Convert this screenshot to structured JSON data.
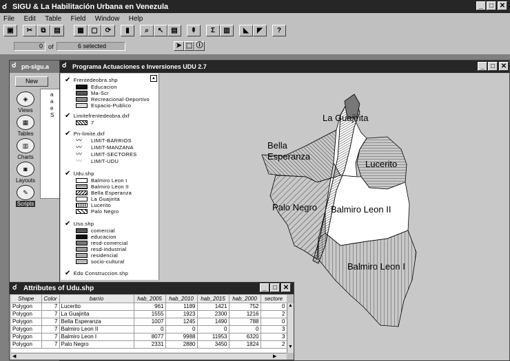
{
  "app": {
    "title": "SIGU & La Habilitación Urbana en Venezula"
  },
  "menu": [
    "File",
    "Edit",
    "Table",
    "Field",
    "Window",
    "Help"
  ],
  "toolbar": {
    "buttons": [
      "save",
      "cut",
      "copy",
      "paste",
      "table-view",
      "layout",
      "refresh",
      "chart",
      "find",
      "query",
      "select-all",
      "promote",
      "sum",
      "stats",
      "clear",
      "sort-asc",
      "sort-desc",
      "help"
    ]
  },
  "status": {
    "count_value": "0",
    "count_of": "of",
    "selected_value": "6",
    "selected_label": "selected"
  },
  "project_window": {
    "title": "pn-sigu.a",
    "new_button": "New",
    "items": [
      "Views",
      "Tables",
      "Charts",
      "Layouts",
      "Scripts"
    ],
    "list": [
      "a",
      "a",
      "e",
      "S"
    ]
  },
  "view_window": {
    "title": "Programa Actuaciones e Inversiones UDU 2.7"
  },
  "legend": {
    "themes": [
      {
        "name": "Frentedeobra.shp",
        "classes": [
          "Educacion",
          "Ma-Scr",
          "Recreacional-Deportivo",
          "Espacio-Publico"
        ]
      },
      {
        "name": "Limitefrentedeobra.dxf",
        "classes": [
          "7"
        ]
      },
      {
        "name": "Pn-limite.dxf",
        "classes": [
          "LIMIT-BARRIOS",
          "LIMIT-MANZANA",
          "LIMIT-SECTORES",
          "LIMIT-UDU"
        ]
      },
      {
        "name": "Udu.shp",
        "classes": [
          "Balmiro Leon I",
          "Balmiro Leon II",
          "Bella Esperanza",
          "La Guajirita",
          "Lucerito",
          "Palo Negro"
        ]
      },
      {
        "name": "Uso.shp",
        "classes": [
          "comercial",
          "educacion",
          "resd-comercial",
          "resd-industrial",
          "residencial",
          "socio-cultural"
        ]
      },
      {
        "name": "Edo Construccion.shp",
        "classes": []
      }
    ]
  },
  "map_labels": {
    "la_guajirita": "La Guajirita",
    "bella_esperanza": "Bella\nEsperanza",
    "lucerito": "Lucerito",
    "palo_negro": "Palo Negro",
    "balmiro_leon_ii": "Balmiro Leon II",
    "balmiro_leon_i": "Balmiro Leon I"
  },
  "attributes_window": {
    "title": "Attributes of Udu.shp",
    "columns": [
      "Shape",
      "Color",
      "barrio",
      "hab_2005",
      "hab_2010",
      "hab_2015",
      "hab_2000",
      "sectore"
    ],
    "rows": [
      [
        "Polygon",
        "7",
        "Lucerito",
        "961",
        "1189",
        "1421",
        "752",
        "0"
      ],
      [
        "Polygon",
        "7",
        "La Guajirita",
        "1555",
        "1923",
        "2300",
        "1216",
        "2"
      ],
      [
        "Polygon",
        "7",
        "Bella Esperanza",
        "1007",
        "1245",
        "1490",
        "788",
        "0"
      ],
      [
        "Polygon",
        "7",
        "Balmiro Leon II",
        "0",
        "0",
        "0",
        "0",
        "3"
      ],
      [
        "Polygon",
        "7",
        "Balmiro Leon I",
        "8077",
        "9988",
        "11953",
        "6320",
        "3"
      ],
      [
        "Polygon",
        "7",
        "Palo Negro",
        "2331",
        "2880",
        "3450",
        "1824",
        "2"
      ]
    ]
  },
  "colors": {
    "titlebar": "#262626",
    "chrome": "#c0c0c0",
    "map_bg": "#c8c8c8"
  }
}
